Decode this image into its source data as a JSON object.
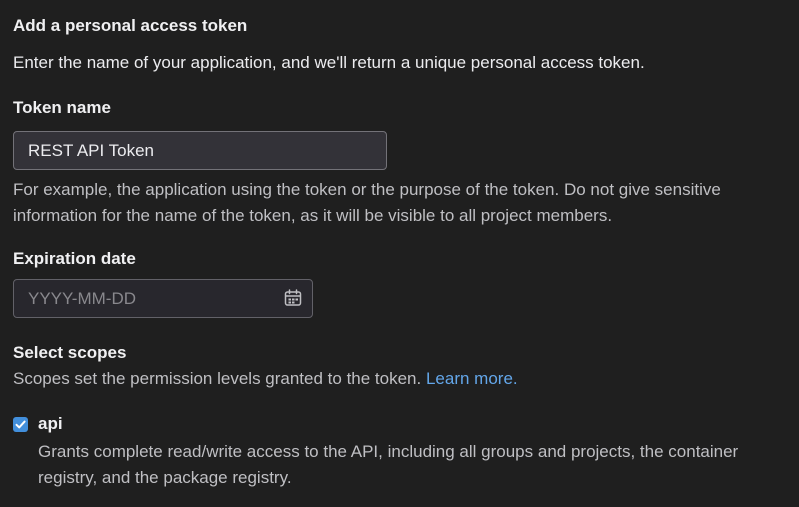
{
  "form": {
    "heading": "Add a personal access token",
    "intro": "Enter the name of your application, and we'll return a unique personal access token."
  },
  "token_name": {
    "label": "Token name",
    "value": "REST API Token",
    "help": "For example, the application using the token or the purpose of the token. Do not give sensitive information for the name of the token, as it will be visible to all project members."
  },
  "expiration": {
    "label": "Expiration date",
    "placeholder": "YYYY-MM-DD",
    "icon": "calendar-icon"
  },
  "scopes": {
    "label": "Select scopes",
    "description": "Scopes set the permission levels granted to the token.",
    "learn_more": "Learn more.",
    "items": [
      {
        "name": "api",
        "checked": true,
        "description": "Grants complete read/write access to the API, including all groups and projects, the container registry, and the package registry."
      }
    ]
  },
  "colors": {
    "background": "#1f1f1f",
    "link": "#63a6e9",
    "checkbox": "#428fdc"
  }
}
